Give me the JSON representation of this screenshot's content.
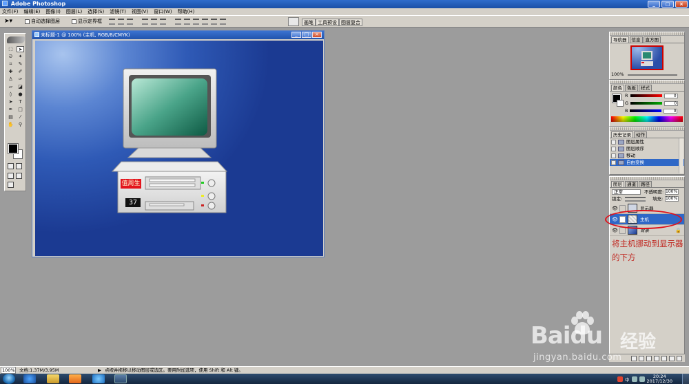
{
  "app": {
    "title": "Adobe Photoshop",
    "window_buttons": [
      "_",
      "□",
      "×"
    ]
  },
  "menu": [
    "文件(F)",
    "编辑(E)",
    "图像(I)",
    "图层(L)",
    "选择(S)",
    "滤镜(T)",
    "视图(V)",
    "窗口(W)",
    "帮助(H)"
  ],
  "options": {
    "tool_icon": "move-tool-icon",
    "auto_select_label": "自动选择图层",
    "show_bounds_label": "显示定界框",
    "well_tabs": [
      "画笔",
      "工具预设",
      "图层复合"
    ]
  },
  "document": {
    "title": "未标题-1 @ 100% (主机, RGB/8/CMYK)",
    "tag_label": "值周生",
    "number_display": "37",
    "colors": {
      "canvas": "#2f5ab6",
      "tag": "#e3141c",
      "screen": "#2a8a72"
    }
  },
  "navigator": {
    "tabs": [
      "导航器",
      "信息",
      "直方图"
    ],
    "zoom": "100%"
  },
  "color_panel": {
    "tabs": [
      "颜色",
      "色板",
      "样式"
    ],
    "channels": [
      {
        "label": "R",
        "value": "0",
        "color": "#d02020"
      },
      {
        "label": "G",
        "value": "0",
        "color": "#20a020"
      },
      {
        "label": "B",
        "value": "0",
        "color": "#2030d0"
      }
    ]
  },
  "history": {
    "tabs": [
      "历史记录",
      "动作"
    ],
    "items": [
      "图层属性",
      "图层顺序",
      "移动",
      "自由变换"
    ]
  },
  "layers": {
    "tabs": [
      "图层",
      "通道",
      "路径"
    ],
    "blend_mode": "正常",
    "opacity_label": "不透明度:",
    "opacity": "100%",
    "lock_label": "锁定:",
    "fill_label": "填充:",
    "fill": "100%",
    "items": [
      {
        "name": "显示器",
        "selected": false
      },
      {
        "name": "主机",
        "selected": true
      },
      {
        "name": "背景",
        "selected": false
      }
    ]
  },
  "annotation": {
    "text": "将主机挪动到显示器的下方",
    "color": "#c0251e"
  },
  "status": {
    "zoom": "100%",
    "doc": "文档:1.37M/3.95M",
    "hint": "点按并拖移以移动图层或选区。要用附加选项，使用 Shift 和 Alt 键。"
  },
  "taskbar": {
    "time": "20:24",
    "date": "2017/12/30",
    "ime": "中"
  },
  "watermark": {
    "logo": "Baidu",
    "cn": "经验",
    "url": "jingyan.baidu.com"
  }
}
